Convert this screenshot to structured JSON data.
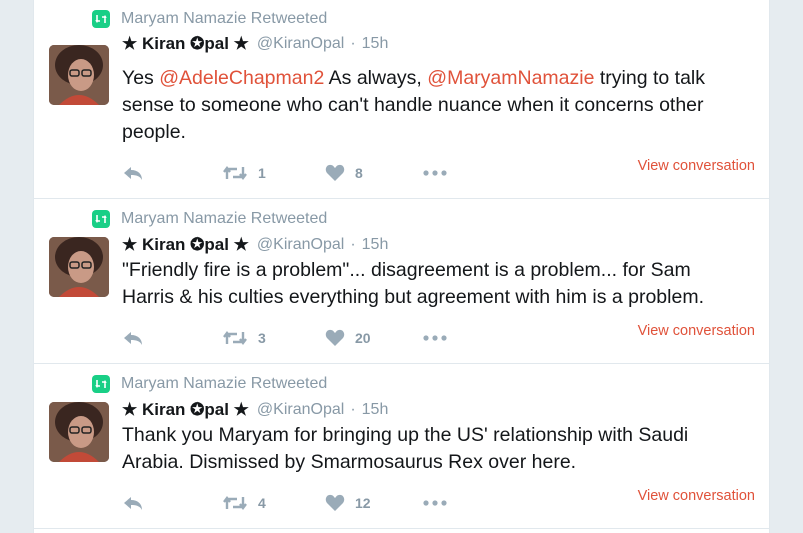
{
  "tweets": [
    {
      "retweeted_by": "Maryam Namazie Retweeted",
      "name": "★ Kiran ✪pal ★",
      "handle": "@KiranOpal",
      "separator": "·",
      "time": "15h",
      "text_parts": [
        {
          "t": "Yes ",
          "mention": false
        },
        {
          "t": "@AdeleChapman2",
          "mention": true
        },
        {
          "t": " As always, ",
          "mention": false
        },
        {
          "t": "@MaryamNamazie",
          "mention": true
        },
        {
          "t": " trying to talk sense to someone who can't handle nuance when it concerns other people.",
          "mention": false
        }
      ],
      "retweets": "1",
      "likes": "8",
      "view_conversation": "View conversation"
    },
    {
      "retweeted_by": "Maryam Namazie Retweeted",
      "name": "★ Kiran ✪pal ★",
      "handle": "@KiranOpal",
      "separator": "·",
      "time": "15h",
      "text_parts": [
        {
          "t": "\"Friendly fire is a problem\"... disagreement is a problem... for Sam Harris & his culties everything but agreement with him is a problem.",
          "mention": false
        }
      ],
      "retweets": "3",
      "likes": "20",
      "view_conversation": "View conversation"
    },
    {
      "retweeted_by": "Maryam Namazie Retweeted",
      "name": "★ Kiran ✪pal ★",
      "handle": "@KiranOpal",
      "separator": "·",
      "time": "15h",
      "text_parts": [
        {
          "t": "Thank you Maryam for bringing up the US' relationship with Saudi Arabia. Dismissed by Smarmosaurus Rex over here.",
          "mention": false
        }
      ],
      "retweets": "4",
      "likes": "12",
      "view_conversation": "View conversation"
    }
  ],
  "colors": {
    "accent": "#e0523a",
    "retweet_badge": "#19cf86",
    "muted": "#8899a6",
    "text": "#14171a"
  },
  "icons": [
    "retweet-badge-icon",
    "reply-icon",
    "retweet-icon",
    "heart-icon",
    "more-icon"
  ]
}
